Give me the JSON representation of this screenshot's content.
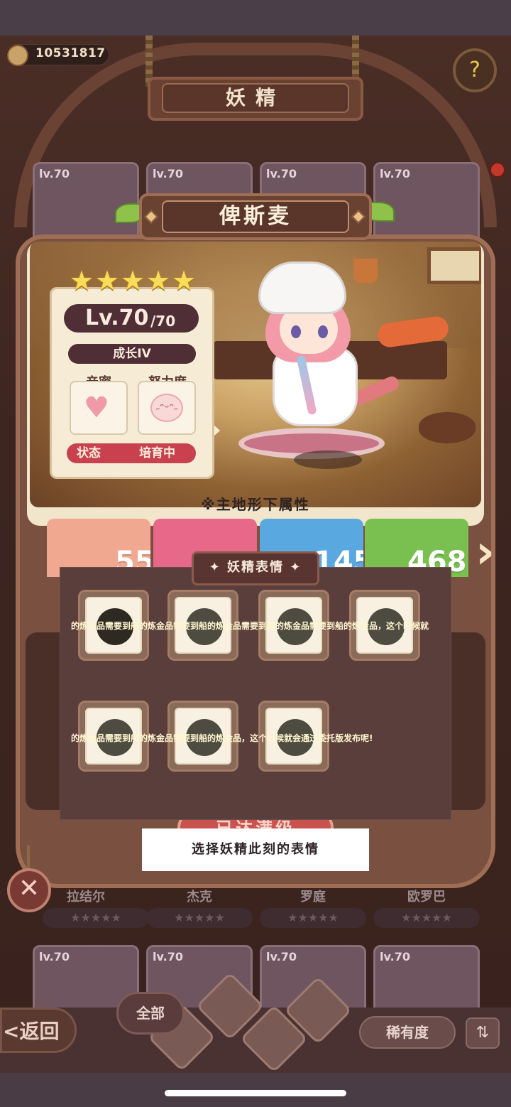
{
  "header": {
    "coins": "10531817",
    "title": "妖精",
    "help_icon": "help-icon"
  },
  "fairy": {
    "name": "俾斯麦",
    "stars": [
      "★",
      "★",
      "★",
      "★",
      "★"
    ],
    "level": "Lv.70",
    "level_max": "/70",
    "growth": "成长IV",
    "intimacy_label": "亲密",
    "effort_label": "努力度",
    "status_label": "状态",
    "status_value": "培育中"
  },
  "terrain": {
    "note": "※主地形下属性",
    "cards": [
      {
        "label": "",
        "value": "55",
        "color": "#f0a890"
      },
      {
        "label": "",
        "value": "",
        "color": "#e8688a"
      },
      {
        "label": "",
        "value": "145",
        "color": "#5aa8e0"
      },
      {
        "label": "",
        "value": "468",
        "color": "#7ac050"
      }
    ]
  },
  "background_cards": {
    "top_row": [
      "lv.70",
      "lv.70",
      "lv.70",
      "lv.70"
    ],
    "bottom_row": [
      "lv.70",
      "lv.70",
      "lv.70",
      "lv.70"
    ],
    "names": [
      "拉结尔",
      "杰克",
      "罗庭",
      "欧罗巴"
    ],
    "stars": "★★★★★",
    "level_up_button": "已达满级"
  },
  "modal": {
    "title": "妖精表情",
    "row1_ticker": "的炼金品需要到船的炼金品需要到船的炼金品需要到船的炼金品需要到船的炼金品，这个时候就",
    "row2_ticker": "的炼金品需要到船的炼金品需要到船的炼金品，这个时候就会通过委托版发布呢!"
  },
  "hint": "选择妖精此刻的表情",
  "nav": {
    "back": "<返回",
    "all": "全部",
    "sort": "稀有度",
    "order_icon": "sort-order-icon"
  }
}
